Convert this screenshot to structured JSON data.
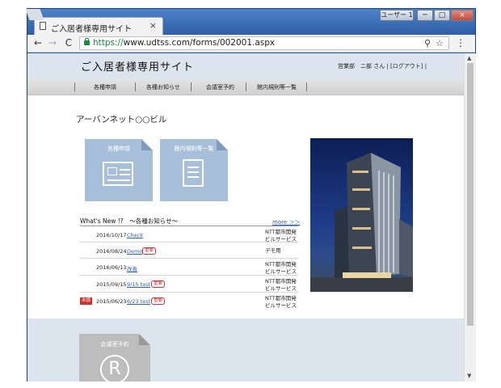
{
  "browser": {
    "tab_title": "ご入居者様専用サイト",
    "tab_close": "×",
    "user_button": "ユーザー 1",
    "minimize": "─",
    "maximize": "□",
    "close": "×",
    "back": "←",
    "forward": "→",
    "reload": "C",
    "url_scheme": "https://",
    "url_rest": "www.udtss.com/forms/002001.aspx",
    "zoom": "⚲",
    "star": "☆",
    "menu": "⋮"
  },
  "site": {
    "title": "ご入居者様専用サイト",
    "user_info": "営業部　ニ部 さん | [ログアウト] |",
    "nav": [
      "各種申請",
      "各種お知らせ",
      "会議室予約",
      "館内規則等一覧"
    ],
    "building_title": "アーバンネット○○ビル",
    "tiles": {
      "apply": "各種申請",
      "rules": "館内規則等一覧",
      "room": "会議室予約",
      "room_icon": "R"
    }
  },
  "news": {
    "header": "What's New !?　～各種お知らせ～",
    "more": "more ＞＞",
    "items": [
      {
        "date": "2016/10/17",
        "link": "Check",
        "badge": "",
        "unread": "",
        "org": "NTT都市開発\nビルサービス"
      },
      {
        "date": "2016/08/24",
        "link": "Demo",
        "badge": "重要",
        "unread": "",
        "org": "デモ用"
      },
      {
        "date": "2016/06/13",
        "link": "改善",
        "badge": "",
        "unread": "",
        "org": "NTT都市開発\nビルサービス"
      },
      {
        "date": "2015/09/15",
        "link": "9/15 test",
        "badge": "重要",
        "unread": "",
        "org": "NTT都市開発\nビルサービス"
      },
      {
        "date": "2015/06/23",
        "link": "6/23 test",
        "badge": "重要",
        "unread": "未読",
        "org": "NTT都市開発\nビルサービス"
      }
    ]
  }
}
